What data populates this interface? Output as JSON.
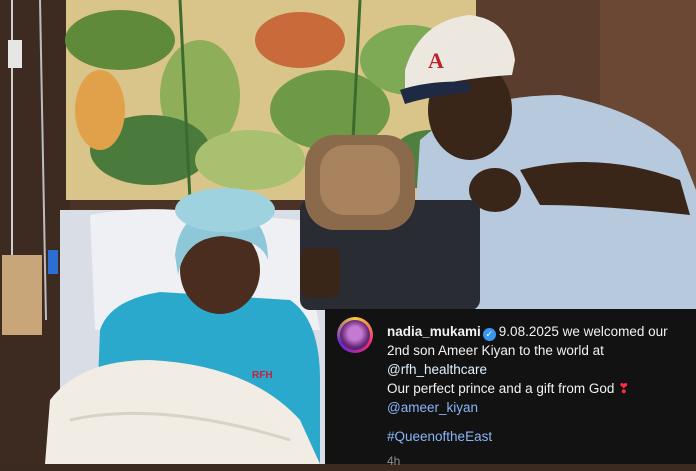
{
  "caption": {
    "username": "nadia_mukami",
    "date": "9.08.2025",
    "text_line1": "we welcomed our",
    "text_line2": "2nd son Ameer Kiyan to the world at",
    "mention1": "@rfh_healthcare",
    "text_line3": "Our perfect prince and a gift from God",
    "heart": "❣",
    "mention2": "@ameer_kiyan",
    "hashtag": "#QueenoftheEast",
    "time": "4h"
  },
  "photo": {
    "gown_text": "RFH",
    "cap_text": "A"
  },
  "colors": {
    "caption_bg": "#121212",
    "mention": "#8ab4f8",
    "verified": "#3897f0"
  }
}
